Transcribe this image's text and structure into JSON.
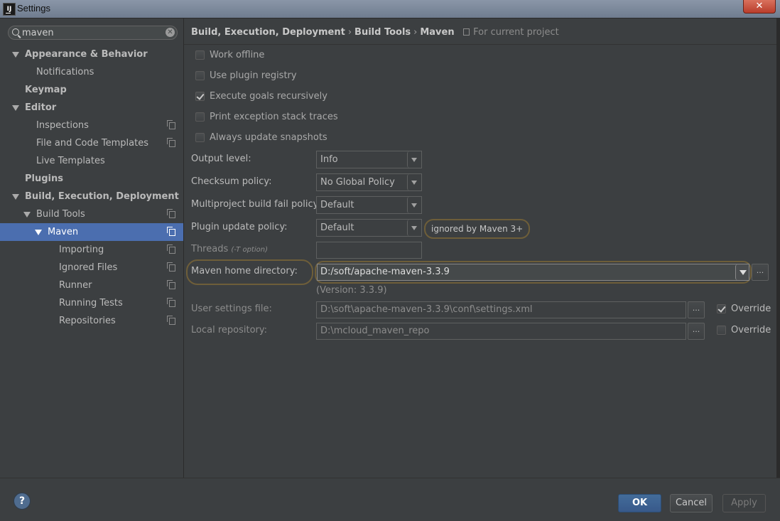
{
  "window": {
    "title": "Settings",
    "app_icon_text": "IJ",
    "close_symbol": "✕"
  },
  "search": {
    "value": "maven",
    "clear_symbol": "✕"
  },
  "sidebar": {
    "items": [
      {
        "label": "Appearance & Behavior",
        "level": 0,
        "expanded": true,
        "bold": true
      },
      {
        "label": "Notifications",
        "level": 1
      },
      {
        "label": "Keymap",
        "level": 0,
        "bold": true
      },
      {
        "label": "Editor",
        "level": 0,
        "expanded": true,
        "bold": true
      },
      {
        "label": "Inspections",
        "level": 1,
        "project_icon": true
      },
      {
        "label": "File and Code Templates",
        "level": 1,
        "project_icon": true
      },
      {
        "label": "Live Templates",
        "level": 1
      },
      {
        "label": "Plugins",
        "level": 0,
        "bold": true
      },
      {
        "label": "Build, Execution, Deployment",
        "level": 0,
        "expanded": true,
        "bold": true
      },
      {
        "label": "Build Tools",
        "level": 1,
        "expanded": true,
        "project_icon": true
      },
      {
        "label": "Maven",
        "level": 2,
        "expanded": true,
        "selected": true,
        "project_icon": true
      },
      {
        "label": "Importing",
        "level": 3,
        "project_icon": true
      },
      {
        "label": "Ignored Files",
        "level": 3,
        "project_icon": true
      },
      {
        "label": "Runner",
        "level": 3,
        "project_icon": true
      },
      {
        "label": "Running Tests",
        "level": 3,
        "project_icon": true
      },
      {
        "label": "Repositories",
        "level": 3,
        "project_icon": true
      }
    ]
  },
  "breadcrumb": {
    "parts": [
      "Build, Execution, Deployment",
      "Build Tools",
      "Maven"
    ],
    "separator": "›",
    "scope": "For current project"
  },
  "options": [
    {
      "label": "Work offline",
      "checked": false
    },
    {
      "label": "Use plugin registry",
      "checked": false
    },
    {
      "label": "Execute goals recursively",
      "checked": true
    },
    {
      "label": "Print exception stack traces",
      "checked": false
    },
    {
      "label": "Always update snapshots",
      "checked": false
    }
  ],
  "fields": {
    "output_level": {
      "label": "Output level:",
      "value": "Info"
    },
    "checksum_policy": {
      "label": "Checksum policy:",
      "value": "No Global Policy"
    },
    "multiproject_policy": {
      "label": "Multiproject build fail policy:",
      "value": "Default"
    },
    "plugin_update_policy": {
      "label": "Plugin update policy:",
      "value": "Default",
      "note": "ignored by Maven 3+"
    },
    "threads": {
      "label": "Threads",
      "hint": "(-T option)",
      "value": ""
    },
    "maven_home": {
      "label": "Maven home directory:",
      "value": "D:/soft/apache-maven-3.3.9",
      "version": "(Version: 3.3.9)",
      "browse": "..."
    },
    "user_settings": {
      "label": "User settings file:",
      "value": "D:\\soft\\apache-maven-3.3.9\\conf\\settings.xml",
      "browse": "...",
      "override_label": "Override",
      "override_checked": true
    },
    "local_repo": {
      "label": "Local repository:",
      "value": "D:\\mcloud_maven_repo",
      "browse": "...",
      "override_label": "Override",
      "override_checked": false
    }
  },
  "footer": {
    "help": "?",
    "ok": "OK",
    "cancel": "Cancel",
    "apply": "Apply"
  },
  "colors": {
    "background": "#3c3f41",
    "selection": "#4b6eaf",
    "highlight_ring": "#6e5e39",
    "ok_button": "#3d6394"
  }
}
